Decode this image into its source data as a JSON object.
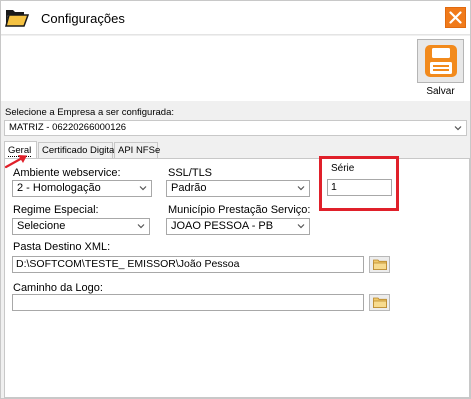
{
  "window": {
    "title": "Configurações"
  },
  "toolbar": {
    "save_label": "Salvar"
  },
  "company": {
    "label": "Selecione a Empresa a ser configurada:",
    "value": "MATRIZ - 06220266000126"
  },
  "tabs": [
    {
      "label": "Geral",
      "active": true
    },
    {
      "label": "Certificado Digital",
      "active": false
    },
    {
      "label": "API NFSe",
      "active": false
    }
  ],
  "geral": {
    "ambiente": {
      "label": "Ambiente webservice:",
      "value": "2 - Homologação"
    },
    "ssl": {
      "label": "SSL/TLS",
      "value": "Padrão"
    },
    "serie": {
      "label": "Série",
      "value": "1"
    },
    "regime": {
      "label": "Regime Especial:",
      "value": "Selecione"
    },
    "municipio": {
      "label": "Município Prestação Serviço:",
      "value": "JOAO PESSOA - PB"
    },
    "pasta": {
      "label": "Pasta Destino XML:",
      "value": "D:\\SOFTCOM\\TESTE_ EMISSOR\\João Pessoa"
    },
    "logo": {
      "label": "Caminho da Logo:",
      "value": ""
    }
  },
  "colors": {
    "accent_close": "#f07a1a",
    "annotation_red": "#e0202a",
    "save_icon_orange": "#f28a1c"
  },
  "icons": [
    "folder-open-icon",
    "close-icon",
    "floppy-disk-icon",
    "chevron-down-icon",
    "folder-icon",
    "annotation-arrow-icon"
  ]
}
